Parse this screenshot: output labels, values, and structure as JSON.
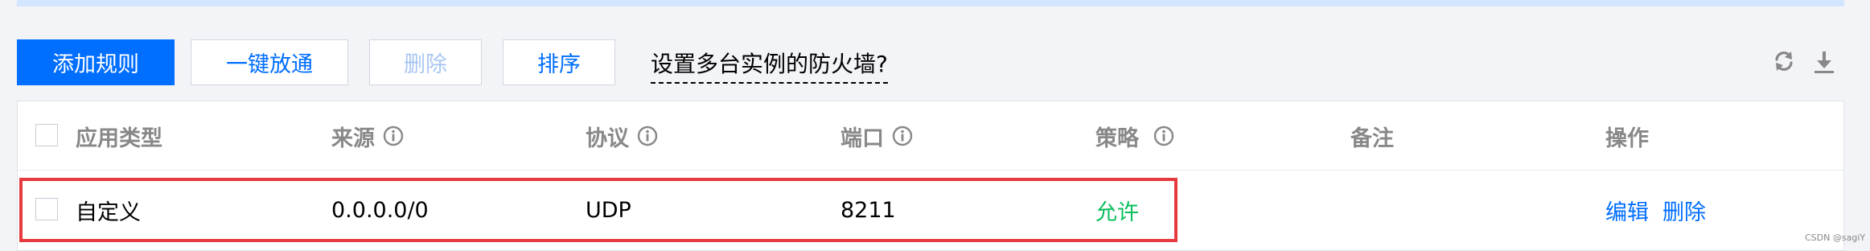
{
  "toolbar": {
    "add_rule": "添加规则",
    "one_click_open": "一键放通",
    "delete": "删除",
    "sort": "排序",
    "help_link": "设置多台实例的防火墙?"
  },
  "icons": {
    "refresh": "refresh-icon",
    "download": "download-icon",
    "info": "info-icon"
  },
  "colors": {
    "accent": "#006eff",
    "allow": "#0abf5b",
    "highlight": "#e53a3f",
    "banner": "#d4e5ff"
  },
  "table": {
    "headers": [
      "应用类型",
      "来源",
      "协议",
      "端口",
      "策略",
      "备注",
      "操作"
    ],
    "rows": [
      {
        "app_type": "自定义",
        "source": "0.0.0.0/0",
        "protocol": "UDP",
        "port": "8211",
        "policy": "允许",
        "remark": "",
        "actions": [
          "编辑",
          "删除"
        ]
      }
    ]
  },
  "watermark": "CSDN @sagiY"
}
